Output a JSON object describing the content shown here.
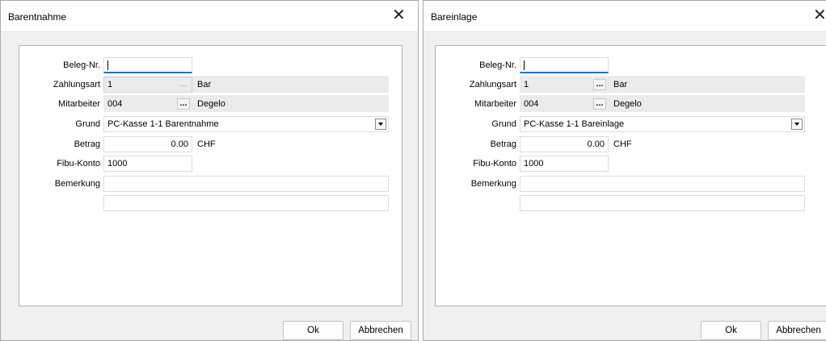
{
  "dialogs": [
    {
      "title": "Barentnahme",
      "labels": {
        "beleg": "Beleg-Nr.",
        "zahlungsart": "Zahlungsart",
        "mitarbeiter": "Mitarbeiter",
        "grund": "Grund",
        "betrag": "Betrag",
        "fibu": "Fibu-Konto",
        "bemerkung": "Bemerkung"
      },
      "values": {
        "beleg": "",
        "zahlungsart": "1",
        "zahlungsart_desc": "Bar",
        "mitarbeiter": "004",
        "mitarbeiter_desc": "Degelo",
        "grund": "PC-Kasse 1-1 Barentnahme",
        "betrag": "0.00",
        "currency": "CHF",
        "fibu": "1000",
        "bemerkung1": "",
        "bemerkung2": ""
      },
      "ellipsis": "...",
      "buttons": {
        "ok": "Ok",
        "cancel": "Abbrechen"
      }
    },
    {
      "title": "Bareinlage",
      "labels": {
        "beleg": "Beleg-Nr.",
        "zahlungsart": "Zahlungsart",
        "mitarbeiter": "Mitarbeiter",
        "grund": "Grund",
        "betrag": "Betrag",
        "fibu": "Fibu-Konto",
        "bemerkung": "Bemerkung"
      },
      "values": {
        "beleg": "",
        "zahlungsart": "1",
        "zahlungsart_desc": "Bar",
        "mitarbeiter": "004",
        "mitarbeiter_desc": "Degelo",
        "grund": "PC-Kasse 1-1 Bareinlage",
        "betrag": "0.00",
        "currency": "CHF",
        "fibu": "1000",
        "bemerkung1": "",
        "bemerkung2": ""
      },
      "ellipsis": "...",
      "buttons": {
        "ok": "Ok",
        "cancel": "Abbrechen"
      }
    }
  ],
  "close_glyph": "✕"
}
